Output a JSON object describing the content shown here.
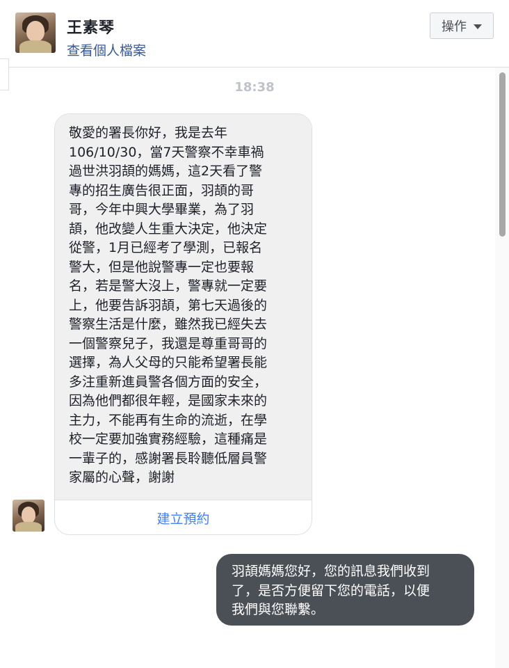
{
  "header": {
    "name": "王素琴",
    "profile_link": "查看個人檔案",
    "action_label": "操作"
  },
  "conversation": {
    "timestamp": "18:38",
    "incoming": {
      "lines": [
        "敬愛的署長你好，我是去年",
        "106/10/30，當7天警察不幸車禍",
        "過世洪羽頡的媽媽，這2天看了警",
        "專的招生廣告很正面，羽頡的哥",
        "哥，今年中興大學畢業，為了羽",
        "頡，他改變人生重大決定，他決定",
        "從警，1月已經考了學測，已報名",
        "警大，但是他說警專一定也要報",
        "名，若是警大沒上，警專就一定要",
        "上，他要告訴羽頡，第七天過後的",
        "警察生活是什麼，雖然我已經失去",
        "一個警察兒子，我還是尊重哥哥的",
        "選擇，為人父母的只能希望署長能",
        "多注重新進員警各個方面的安全，",
        "因為他們都很年輕，是國家未來的",
        "主力，不能再有生命的流逝，在學",
        "校一定要加強實務經驗，這種痛是",
        "一輩子的，感謝署長聆聽低層員警",
        "家屬的心聲，謝謝"
      ],
      "cta_label": "建立預約"
    },
    "outgoing": {
      "lines": [
        "羽頡媽媽您好，您的訊息我們收到",
        "了，是否方便留下您的電話，以便",
        "我們與您聯繫。"
      ]
    }
  },
  "colors": {
    "link": "#365899",
    "cta": "#4080ff",
    "incoming_bg": "#f1f0f0",
    "outgoing_bg": "#4b4f56"
  }
}
